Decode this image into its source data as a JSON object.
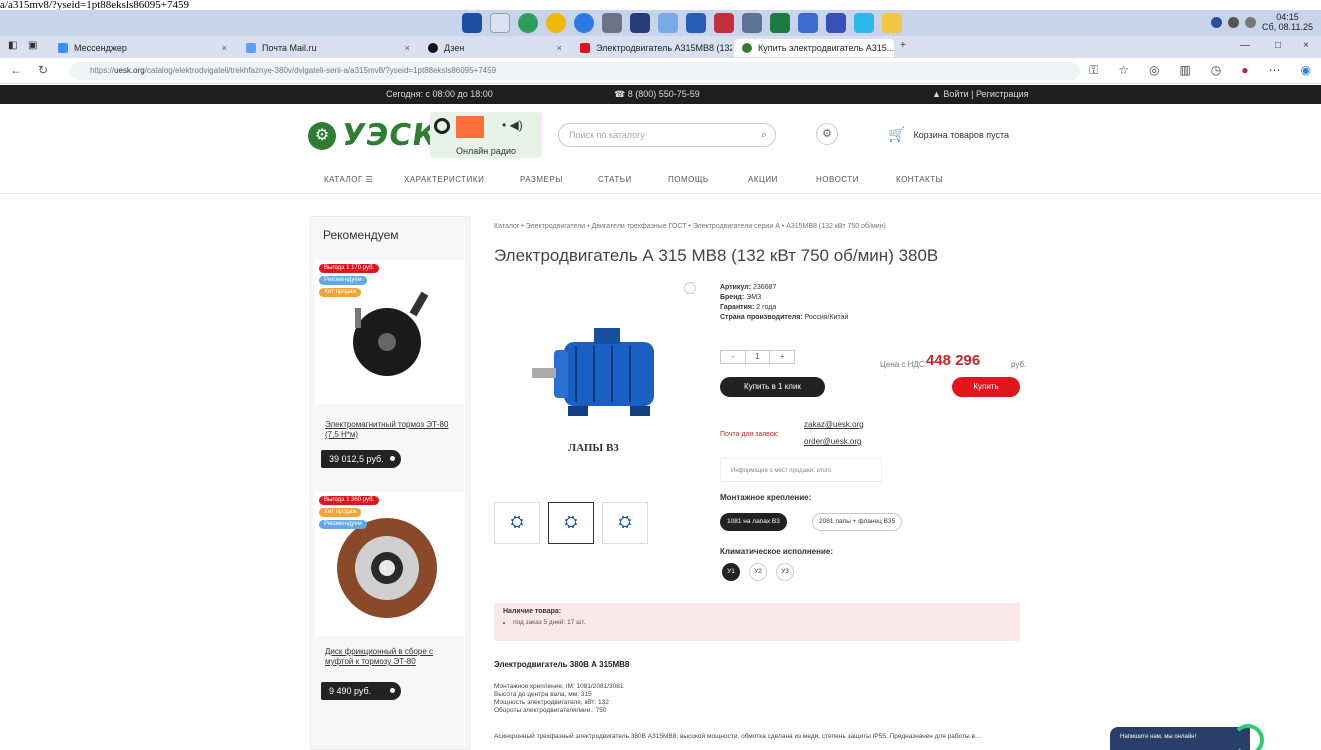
{
  "url_remnant": "a/a315mv8/?yseid=1pt88eksls86095+7459",
  "taskbar": {
    "clock_time": "04:15",
    "clock_date": "Сб, 08.11.25"
  },
  "tabs": [
    {
      "label": "Мессенджер"
    },
    {
      "label": "Почта Mail.ru"
    },
    {
      "label": "Дзен"
    },
    {
      "label": "Электродвигатель А315МВ8 (132 кВт...)"
    },
    {
      "label": "Купить электродвигатель А315..."
    }
  ],
  "address": {
    "url_prefix": "https://",
    "url_domain": "uesk.org",
    "url_path": "/catalog/elektrodvigateli/trekhfaznye-380v/dvigateli-serii-a/a315mv8/?yseid=1pt88eksls86095+7459"
  },
  "topstrip": {
    "hours": "Сегодня: с 08:00 до 18:00",
    "phone": "8 (800) 550-75-59",
    "login": "Войти | Регистрация"
  },
  "header": {
    "logo_text": "УЭСК",
    "radio_label": "Онлайн радио",
    "search_placeholder": "Поиск по каталогу",
    "cart_text": "Корзина товаров пуста"
  },
  "nav": [
    {
      "label": "КАТАЛОГ"
    },
    {
      "label": "ХАРАКТЕРИСТИКИ"
    },
    {
      "label": "РАЗМЕРЫ"
    },
    {
      "label": "СТАТЬИ"
    },
    {
      "label": "ПОМОЩЬ"
    },
    {
      "label": "АКЦИИ"
    },
    {
      "label": "НОВОСТИ"
    },
    {
      "label": "КОНТАКТЫ"
    }
  ],
  "sidebar": {
    "title": "Рекомендуем",
    "products": [
      {
        "badges": [
          "Выгода 1 170 руб.",
          "Рекомендуем",
          "Хит продаж"
        ],
        "name": "Электромагнитный тормоз ЭТ-80 (7,5 Н*м)",
        "price": "39 012,5 руб."
      },
      {
        "badges": [
          "Выгода 1 360 руб.",
          "Хит продаж",
          "Рекомендуем"
        ],
        "name": "Диск фрикционный в сборе с муфтой к тормозу ЭТ-80",
        "price": "9 490 руб."
      }
    ]
  },
  "breadcrumb": "Каталог  •  Электродвигатели  •  Двигатели трехфазные ГОСТ  •  Электродвигатели серии А  •  А315МВ8 (132 кВт 750 об/мин)",
  "product": {
    "title": "Электродвигатель А 315 МВ8 (132 кВт 750 об/мин) 380В",
    "image_caption": "ЛАПЫ В3",
    "article_label": "Артикул:",
    "article": "236687",
    "brand_label": "Бренд:",
    "brand": "ЭМЗ",
    "warranty_label": "Гарантия:",
    "warranty": "2 года",
    "country_label": "Страна производителя:",
    "country": "Россия/Китай",
    "qty_minus": "-",
    "qty": "1",
    "qty_plus": "+",
    "price_label": "Цена с НДС:",
    "price": "448 296",
    "currency": "руб.",
    "oneclick_label": "Купить в 1 клик",
    "buy_label": "Купить",
    "contacts_label": "Почта для заявок:",
    "email_sales": "zakaz@uesk.org",
    "email_order": "order@uesk.org",
    "notice": "Информация о мест продажи: итого",
    "mount_heading": "Монтажное крепление:",
    "mount_options": [
      "1081 на лапах В3",
      "2081 лапы + фланец В35"
    ],
    "climate_heading": "Климатическое исполнение:",
    "climate_options": [
      "У1",
      "У2",
      "У3"
    ]
  },
  "stock": {
    "heading": "Наличие товара:",
    "item": "под заказ 5 дней: 17 шт."
  },
  "description": {
    "title": "Электродвигатель 380В А 315МВ8",
    "lines": [
      "Монтажное крепление, IM: 1081/2081/3081",
      "Высота до центра вала, мм: 315",
      "Мощность электродвигателя, кВт: 132",
      "Обороты электродвигателя/мин.: 750"
    ],
    "paragraph": "Асинхронный трехфазный электродвигатель 380В А315МВ8, высокой мощности, обмотка сделана из меди, степень защиты IP55. Предназначен для работы в..."
  },
  "chat": {
    "label": "Напишите нам, мы онлайн!"
  }
}
